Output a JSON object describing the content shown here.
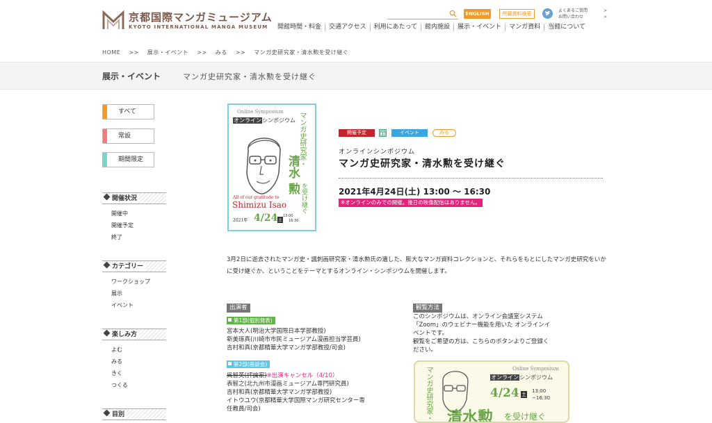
{
  "header": {
    "logo_jp": "京都国際マンガミュージアム",
    "logo_en": "KYOTO INTERNATIONAL MANGA MUSEUM",
    "search_placeholder": "",
    "english_label": "ENGLISH",
    "catalog_label": "所蔵資料検索",
    "faq_label": "よくあるご質問",
    "contact_label": "お問い合わせ",
    "arrow": ">",
    "nav": [
      "開館時間・料金",
      "交通アクセス",
      "利用にあたって",
      "館内施設",
      "展示・イベント",
      "マンガ資料",
      "当館について"
    ],
    "icons": {
      "search": "search-icon",
      "twitter": "twitter-icon"
    }
  },
  "breadcrumb": [
    "HOME",
    ">>",
    "展示・イベント",
    ">>",
    "みる",
    ">>",
    "マンガ史研究家・清水勲を受け継ぐ"
  ],
  "band": {
    "title": "展示・イベント",
    "subtitle": "マンガ史研究家・清水勲を受け継ぐ"
  },
  "sidebar": {
    "categories": [
      {
        "label": "すべて",
        "color": "#ef9a2a"
      },
      {
        "label": "常設",
        "color": "#ee7d80"
      },
      {
        "label": "期間限定",
        "color": "#7fd3c7"
      }
    ],
    "sections": [
      {
        "title": "開催状況",
        "items": [
          "開催中",
          "開催予定",
          "終了"
        ]
      },
      {
        "title": "カテゴリー",
        "items": [
          "ワークショップ",
          "展示",
          "イベント"
        ]
      },
      {
        "title": "楽しみ方",
        "items": [
          "よむ",
          "みる",
          "きく",
          "つくる"
        ]
      },
      {
        "title": "目別"
      }
    ]
  },
  "poster": {
    "top": "Online Symposium",
    "badge": "オンライン",
    "badge_rest": "シンポジウム",
    "v1": "マンガ史研究家・",
    "v2": "清水",
    "v3": "勲",
    "v4": "を受け継ぐ",
    "gratitude": "All of our gratitude to",
    "name": "Shimizu Isao",
    "date_year": "2021年",
    "date": "4/24",
    "day": "土",
    "time1": "13:00",
    "time2": "16:30"
  },
  "event": {
    "tags": [
      {
        "label": "開催予定",
        "color": "#c0262c"
      },
      {
        "label": "",
        "color": "#49a87b"
      },
      {
        "label": "イベント",
        "color": "#3ca6e0"
      },
      {
        "label": "みる",
        "color": "#ef9a2a"
      }
    ],
    "kicker": "オンラインシンポジウム",
    "title": "マンガ史研究家・清水勲を受け継ぐ",
    "datetime": "2021年4月24日(土) 13:00 〜 16:30",
    "note": "※オンラインのみでの開催。後日の映像配信はありません。",
    "description": "3月2日に逝去されたマンガ史・諷刺画研究家・清水勲氏の遺した、膨大なマンガ資料コレクションと、それらをもとにしたマンガ史研究をいかに受け継ぐか、ということをテーマとするオンライン・シンポジウムを開催します。"
  },
  "speakers": {
    "heading": "出演者",
    "part1": {
      "label": "第1部(個別発表)",
      "color": "#5fb548"
    },
    "part1_people": [
      "宮本大人(明治大学国際日本学部教授)",
      "新美琢真(川崎市市民ミュージアム漫画担当学芸員)",
      "吉村和真(京都精華大学マンガ学部教授/司会)"
    ],
    "part2": {
      "label": "第2部(座談会)",
      "color": "#63c3e0"
    },
    "cancelled_name": "呉智英(評論家)",
    "cancel_note": "※出演キャンセル（4/10）",
    "part2_people": [
      "表智之(北九州市漫画ミュージアム専門研究員)",
      "吉村和真(京都精華大学マンガ学部教授)",
      "イトウユウ(京都精華大学国際マンガ研究センター専",
      "任教員/司会)"
    ]
  },
  "viewing": {
    "heading": "観覧方法",
    "lines": [
      "このシンポジウムは、オンライン会議室システム",
      "「Zoom」のウェビナー機能を用いた オンラインイ",
      "ベントです。",
      "観覧をご希望の方は、こちらのボタンよりご登録く",
      "ださい。"
    ]
  },
  "poster2": {
    "top": "Online Symposium",
    "badge": "オンライン",
    "badge_rest": "シンポジウム",
    "v1": "マンガ史研究家・",
    "date": "4/24",
    "day": "土",
    "time1": "13:00",
    "time2": "~16:30",
    "big": "清水勲",
    "rest": "を受け継ぐ"
  }
}
